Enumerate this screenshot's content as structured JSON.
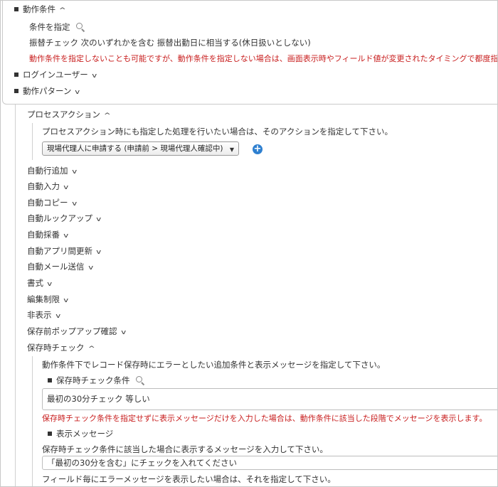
{
  "top": {
    "section_title": "動作条件",
    "condition_label": "条件を指定",
    "condition_value": "振替チェック 次のいずれかを含む 振替出勤日に相当する(休日扱いとしない)",
    "warning": "動作条件を指定しないことも可能ですが、動作条件を指定しない場合は、画面表示時やフィールド値が変更されたタイミングで都度指定した",
    "login_user": "ログインユーザー",
    "action_pattern": "動作パターン"
  },
  "process": {
    "title": "プロセスアクション",
    "description": "プロセスアクション時にも指定した処理を行いたい場合は、そのアクションを指定して下さい。",
    "selected_action": "現場代理人に申請する (申請前 > 現場代理人確認中)",
    "add_icon": "plus-circle-icon"
  },
  "menu": [
    "自動行追加",
    "自動入力",
    "自動コピー",
    "自動ルックアップ",
    "自動採番",
    "自動アプリ間更新",
    "自動メール送信",
    "書式",
    "編集制限",
    "非表示",
    "保存前ポップアップ確認"
  ],
  "save_check": {
    "title": "保存時チェック",
    "description": "動作条件下でレコード保存時にエラーとしたい追加条件と表示メッセージを指定して下さい。",
    "condition_label": "保存時チェック条件",
    "condition_value": "最初の30分チェック 等しい",
    "warning": "保存時チェック条件を指定せずに表示メッセージだけを入力した場合は、動作条件に該当した段階でメッセージを表示します。",
    "message_label": "表示メッセージ",
    "message_hint": "保存時チェック条件に該当した場合に表示するメッセージを入力して下さい。",
    "message_value": "「最初の30分を含む」にチェックを入れてください",
    "field_hint": "フィールド毎にエラーメッセージを表示したい場合は、それを指定して下さい。"
  },
  "colors": {
    "warning": "#c81e1e",
    "accent": "#2f80d0"
  }
}
